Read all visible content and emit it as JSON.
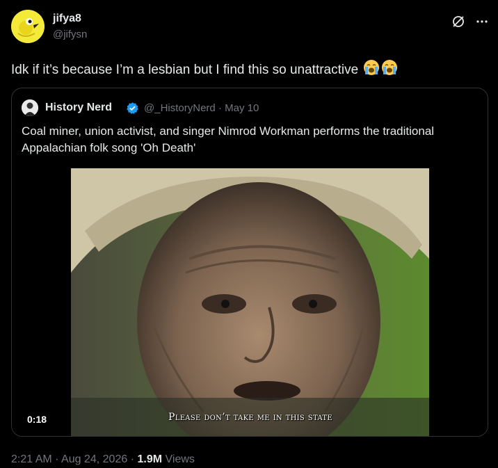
{
  "post": {
    "display_name": "jifya8",
    "handle": "@jifysn",
    "text": "Idk if it’s because I’m a lesbian but I find this so unattractive",
    "emoji": [
      "crying-face-emoji",
      "crying-face-emoji"
    ]
  },
  "quote": {
    "display_name": "History Nerd",
    "handle": "@_HistoryNerd",
    "separator": "·",
    "date": "May 10",
    "text": "Coal miner, union activist, and singer Nimrod Workman performs the traditional Appalachian folk song 'Oh Death'",
    "video": {
      "duration": "0:18",
      "subtitle": "Please don’t take me in this state"
    }
  },
  "footer": {
    "time": "2:21 AM",
    "sep1": "·",
    "date": "Aug 24, 2026",
    "sep2": "·",
    "views_count": "1.9M",
    "views_label": "Views"
  },
  "colors": {
    "background": "#000000",
    "text": "#e7e9ea",
    "muted": "#71767b",
    "border": "#2f3336",
    "verified": "#1d9bf0"
  }
}
